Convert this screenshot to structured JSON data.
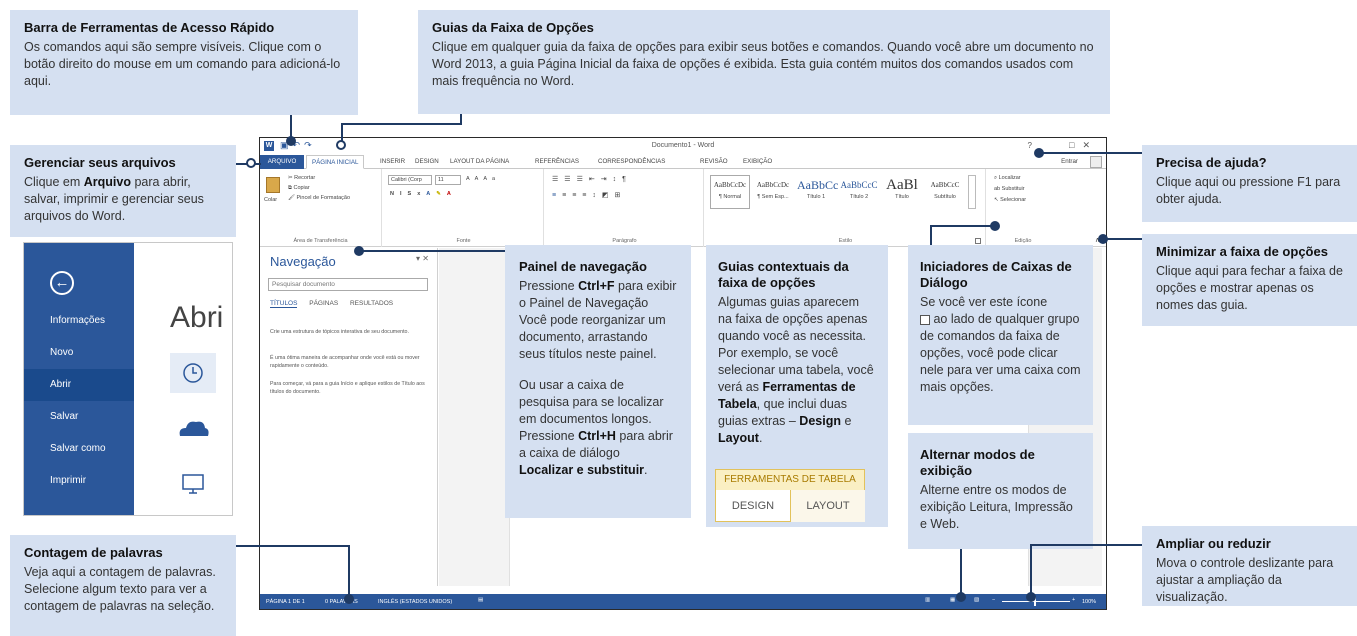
{
  "qat": {
    "title": "Barra de Ferramentas de Acesso Rápido",
    "body": "Os comandos aqui são sempre visíveis. Clique com o botão direito do mouse em um comando para adicioná-lo aqui."
  },
  "tabs_callout": {
    "title": "Guias da Faixa de Opções",
    "body": "Clique em qualquer guia da faixa de opções para exibir seus botões e comandos. Quando você abre um documento no Word 2013, a guia Página Inicial da faixa de opções é exibida. Esta guia contém muitos dos comandos usados com mais frequência no Word."
  },
  "files": {
    "title": "Gerenciar seus arquivos",
    "body_pre": "Clique em ",
    "body_bold": "Arquivo",
    "body_post": " para abrir, salvar, imprimir e gerenciar seus arquivos do Word."
  },
  "help": {
    "title": "Precisa de ajuda?",
    "body": "Clique aqui ou pressione F1 para obter ajuda."
  },
  "minimize": {
    "title": "Minimizar a faixa de opções",
    "body": "Clique aqui para fechar a faixa de opções e mostrar apenas os nomes das guia."
  },
  "nav_callout": {
    "title": "Painel de navegação",
    "p1_pre": "Pressione ",
    "p1_bold": "Ctrl+F",
    "p1_post": " para exibir o Painel de Navegação Você pode reorganizar um documento, arrastando seus títulos neste painel.",
    "p2_pre": "Ou usar a caixa de pesquisa para se localizar em documentos longos. Pressione ",
    "p2_bold": "Ctrl+H",
    "p2_mid": " para abrir a caixa de diálogo ",
    "p2_bold2": "Localizar e substituir",
    "p2_post": "."
  },
  "ctx_callout": {
    "title": "Guias contextuais da faixa de opções",
    "body_pre": "Algumas guias aparecem na faixa de opções apenas quando você as necessita. Por exemplo, se você selecionar uma tabela, você verá as ",
    "bold1": "Ferramentas de Tabela",
    "body_mid": ", que inclui duas guias extras – ",
    "bold2": "Design",
    "and": " e ",
    "bold3": "Layout",
    "end": "."
  },
  "ctx_sample": {
    "header": "FERRAMENTAS DE TABELA",
    "tab1": "DESIGN",
    "tab2": "LAYOUT"
  },
  "dialog_callout": {
    "title": "Iniciadores de Caixas de Diálogo",
    "body_pre": "Se você ver este ícone",
    "body_post": " ao lado de qualquer grupo de comandos da faixa de opções, você pode clicar nele para ver uma caixa com mais opções."
  },
  "views_callout": {
    "title": "Alternar modos de exibição",
    "body": "Alterne entre os modos de exibição Leitura, Impressão e Web."
  },
  "zoom_callout": {
    "title": "Ampliar ou reduzir",
    "body": "Mova o controle deslizante para ajustar a ampliação da visualização."
  },
  "words_callout": {
    "title": "Contagem de palavras",
    "body": "Veja aqui a contagem de palavras. Selecione algum texto para ver a contagem de palavras na seleção."
  },
  "word": {
    "doc_title": "Documento1 - Word",
    "help_q": "?",
    "entrar": "Entrar",
    "tabs": [
      "ARQUIVO",
      "PÁGINA INICIAL",
      "INSERIR",
      "DESIGN",
      "LAYOUT DA PÁGINA",
      "REFERÊNCIAS",
      "CORRESPONDÊNCIAS",
      "REVISÃO",
      "EXIBIÇÃO"
    ],
    "clipboard": {
      "paste": "Colar",
      "cut": "Recortar",
      "copy": "Copiar",
      "painter": "Pincel de Formatação",
      "label": "Área de Transferência"
    },
    "font": {
      "name": "Calibri (Corp",
      "size": "11",
      "label": "Fonte"
    },
    "paragraph_label": "Parágrafo",
    "styles": [
      {
        "sample": "AaBbCcDc",
        "name": "¶ Normal"
      },
      {
        "sample": "AaBbCcDc",
        "name": "¶ Sem Esp..."
      },
      {
        "sample": "AaBbCc",
        "name": "Título 1"
      },
      {
        "sample": "AaBbCcC",
        "name": "Título 2"
      },
      {
        "sample": "AaBl",
        "name": "Título"
      },
      {
        "sample": "AaBbCcC",
        "name": "Subtítulo"
      }
    ],
    "styles_label": "Estilo",
    "editing": {
      "find": "Localizar",
      "replace": "Substituir",
      "select": "Selecionar",
      "label": "Edição"
    },
    "nav": {
      "title": "Navegação",
      "search_placeholder": "Pesquisar documento",
      "tabs": [
        "TÍTULOS",
        "PÁGINAS",
        "RESULTADOS"
      ],
      "p1": "Crie uma estrutura de tópicos interativa de seu documento.",
      "p2": "É uma ótima maneira de acompanhar onde você está ou mover rapidamente o conteúdo.",
      "p3": "Para começar, vá para a guia Início e aplique estilos de Título aos títulos do documento."
    },
    "status": {
      "page": "PÁGINA 1 DE 1",
      "words": "0 PALAVRAS",
      "lang": "INGLÊS (ESTADOS UNIDOS)",
      "zoom": "100%"
    }
  },
  "backstage": {
    "items": [
      "Informações",
      "Novo",
      "Abrir",
      "Salvar",
      "Salvar como",
      "Imprimir"
    ],
    "heading": "Abri"
  }
}
